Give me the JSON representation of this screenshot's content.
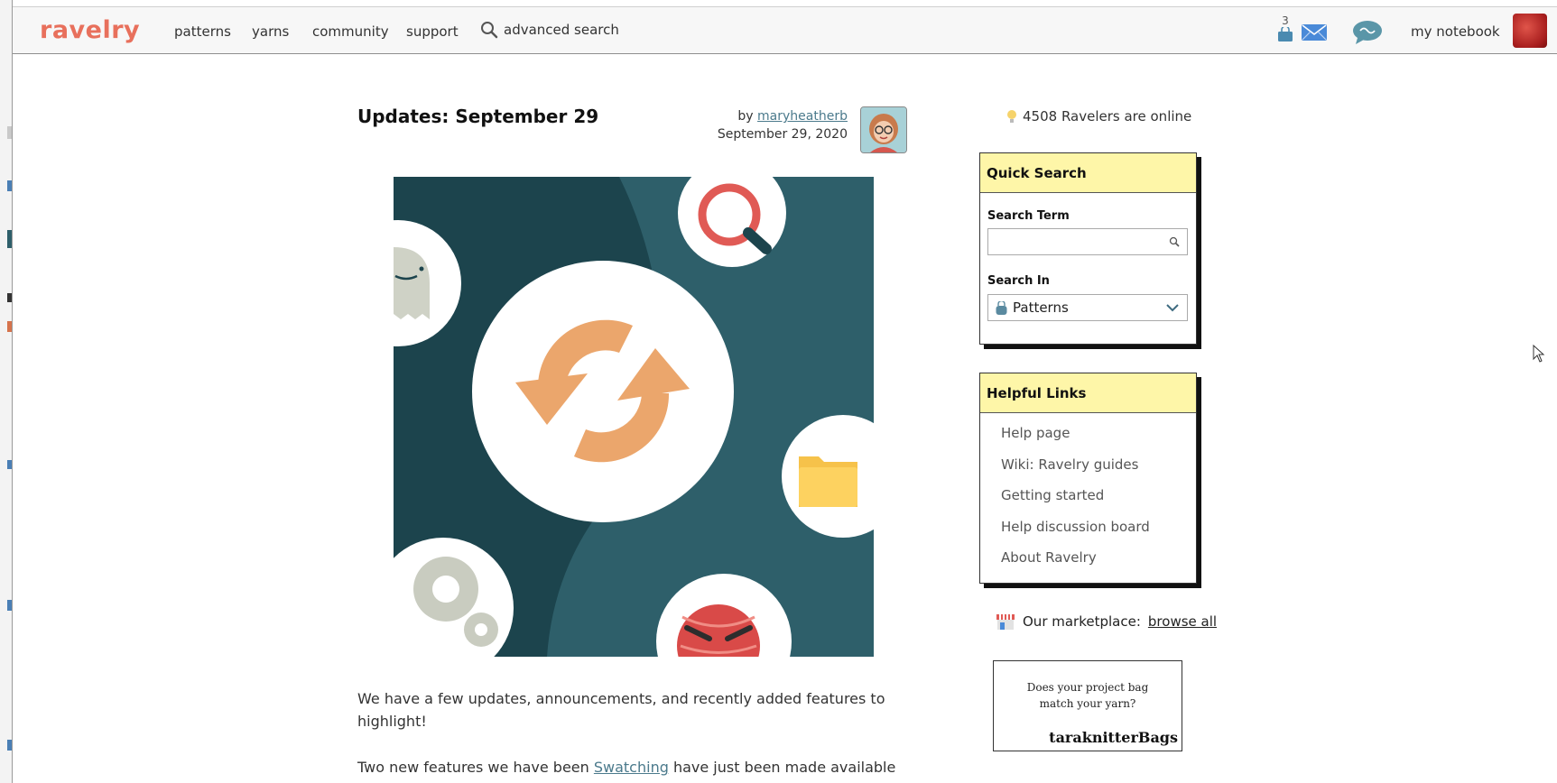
{
  "nav": {
    "logo": "ravelry",
    "items": [
      "patterns",
      "yarns",
      "community",
      "support"
    ],
    "advanced_search": "advanced search",
    "bag_count": "3",
    "my_notebook": "my notebook"
  },
  "article": {
    "title": "Updates: September 29",
    "by_prefix": "by",
    "author": "maryheatherb",
    "date": "September 29, 2020",
    "para1": "We have a few updates, announcements, and recently added features to highlight!",
    "para2_pre": "Two new features we have been ",
    "para2_link": "Swatching",
    "para2_post": " have just been made available for all"
  },
  "sidebar": {
    "online": "4508 Ravelers are online",
    "quick_search": {
      "title": "Quick Search",
      "term_label": "Search Term",
      "term_value": "",
      "in_label": "Search In",
      "in_value": "Patterns"
    },
    "helpful_links": {
      "title": "Helpful Links",
      "items": [
        "Help page",
        "Wiki: Ravelry guides",
        "Getting started",
        "Help discussion board",
        "About Ravelry"
      ]
    },
    "marketplace": {
      "label": "Our marketplace:",
      "link": "browse all"
    },
    "ad": {
      "line1": "Does your project bag",
      "line2": "match your yarn?",
      "brand": "taraknitterBags"
    }
  },
  "colors": {
    "logo": "#e8705c",
    "box_header": "#fef6a8",
    "link": "#4b7a8c",
    "hero_bg": "#2e5f6a",
    "hero_accent": "#eba66c"
  }
}
